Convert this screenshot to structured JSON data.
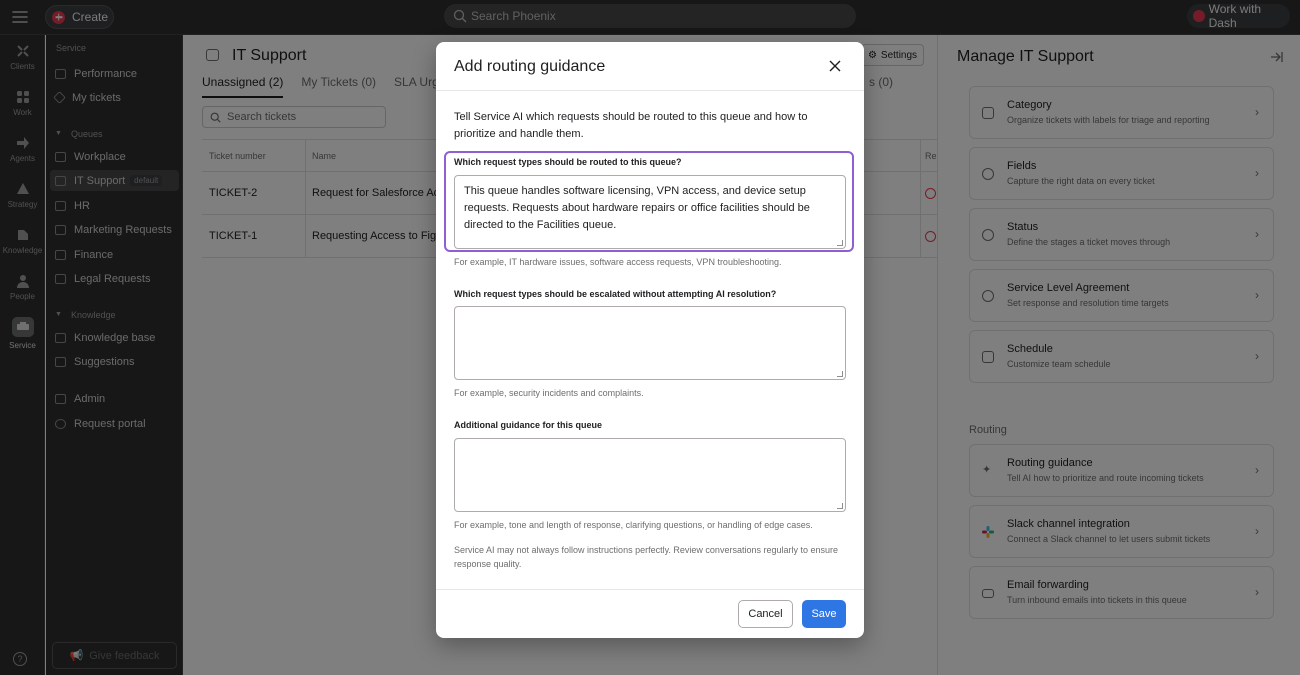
{
  "topbar": {
    "create_label": "Create",
    "search_placeholder": "Search Phoenix",
    "dash_label": "Work with Dash"
  },
  "rail": {
    "items": [
      {
        "label": "Clients",
        "icon": "clients-icon"
      },
      {
        "label": "Work",
        "icon": "work-icon"
      },
      {
        "label": "Agents",
        "icon": "agents-icon"
      },
      {
        "label": "Strategy",
        "icon": "strategy-icon"
      },
      {
        "label": "Knowledge",
        "icon": "knowledge-icon"
      },
      {
        "label": "People",
        "icon": "people-icon"
      },
      {
        "label": "Service",
        "icon": "service-icon"
      }
    ]
  },
  "sidebar": {
    "section_service": "Service",
    "performance": "Performance",
    "my_tickets": "My tickets",
    "section_queues": "Queues",
    "queues": [
      "Workplace",
      "IT Support",
      "HR",
      "Marketing Requests",
      "Finance",
      "Legal Requests"
    ],
    "default_tag": "default",
    "section_knowledge": "Knowledge",
    "knowledge_base": "Knowledge base",
    "suggestions": "Suggestions",
    "admin": "Admin",
    "request_portal": "Request portal",
    "give_feedback": "Give feedback"
  },
  "main": {
    "title": "IT Support",
    "settings_label": "Settings",
    "tabs": [
      "Unassigned (2)",
      "My Tickets (0)",
      "SLA Urge"
    ],
    "tab_right": "s (0)",
    "search_placeholder": "Search tickets",
    "columns": [
      "Ticket number",
      "Name",
      "Re"
    ],
    "rows": [
      {
        "number": "TICKET-2",
        "name": "Request for Salesforce Ac"
      },
      {
        "number": "TICKET-1",
        "name": "Requesting Access to Fig"
      }
    ]
  },
  "right_panel": {
    "title": "Manage IT Support",
    "cards": [
      {
        "title": "Category",
        "sub": "Organize tickets with labels for triage and reporting"
      },
      {
        "title": "Fields",
        "sub": "Capture the right data on every ticket"
      },
      {
        "title": "Status",
        "sub": "Define the stages a ticket moves through"
      },
      {
        "title": "Service Level Agreement",
        "sub": "Set response and resolution time targets"
      },
      {
        "title": "Schedule",
        "sub": "Customize team schedule"
      }
    ],
    "routing_section": "Routing",
    "routing_cards": [
      {
        "title": "Routing guidance",
        "sub": "Tell AI how to prioritize and route incoming tickets"
      },
      {
        "title": "Slack channel integration",
        "sub": "Connect a Slack channel to let users submit tickets"
      },
      {
        "title": "Email forwarding",
        "sub": "Turn inbound emails into tickets in this queue"
      }
    ]
  },
  "modal": {
    "title": "Add routing guidance",
    "intro": "Tell Service AI which requests should be routed to this queue and how to prioritize and handle them.",
    "field1_label": "Which request types should be routed to this queue?",
    "field1_value": "This queue handles software licensing, VPN access, and device setup requests. Requests about hardware repairs or office facilities should be directed to the Facilities queue.",
    "field1_hint": "For example, IT hardware issues, software access requests, VPN troubleshooting.",
    "field2_label": "Which request types should be escalated without attempting AI resolution?",
    "field2_value": "",
    "field2_hint": "For example, security incidents and complaints.",
    "field3_label": "Additional guidance for this queue",
    "field3_value": "",
    "field3_hint": "For example, tone and length of response, clarifying questions, or handling of edge cases.",
    "disclaimer": "Service AI may not always follow instructions perfectly. Review conversations regularly to ensure response quality.",
    "cancel_label": "Cancel",
    "save_label": "Save"
  },
  "colors": {
    "accent": "#2f76e5",
    "focus": "#8d5fd3",
    "brand": "#e8384f"
  }
}
